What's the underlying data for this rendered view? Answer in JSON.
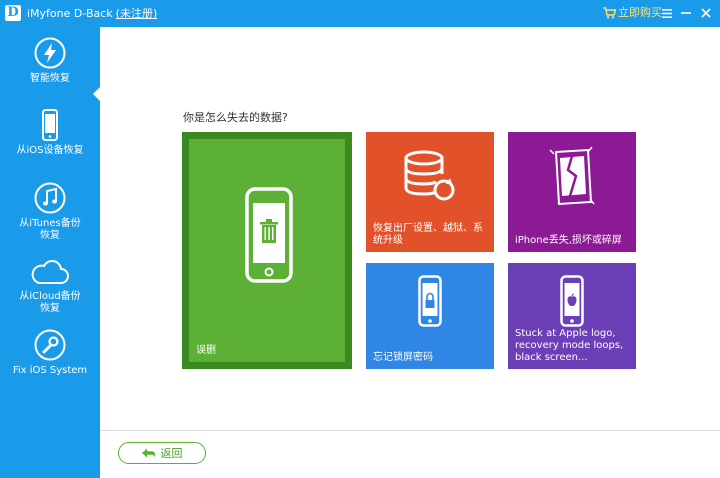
{
  "titlebar": {
    "logo_letter": "D",
    "app_name": "iMyfone D-Back",
    "registration": "(未注册)",
    "buy_label": "立即购买"
  },
  "sidebar": {
    "items": [
      {
        "label": "智能恢复",
        "icon": "lightning-icon"
      },
      {
        "label": "从iOS设备恢复",
        "icon": "iphone-icon"
      },
      {
        "label": "从iTunes备份\n恢复",
        "icon": "music-note-icon"
      },
      {
        "label": "从iCloud备份\n恢复",
        "icon": "cloud-icon"
      },
      {
        "label": "Fix iOS System",
        "icon": "wrench-icon"
      }
    ]
  },
  "main": {
    "question": "你是怎么失去的数据?",
    "tiles": [
      {
        "label": "误删",
        "icon": "phone-trash-icon",
        "color": "#5cb035"
      },
      {
        "label": "恢复出厂设置、越狱、系统升级",
        "icon": "database-restore-icon",
        "color": "#e2522a"
      },
      {
        "label": "iPhone丢失,损坏或碎屏",
        "icon": "broken-phone-icon",
        "color": "#8d1a95"
      },
      {
        "label": "忘记锁屏密码",
        "icon": "phone-lock-icon",
        "color": "#2f86e4"
      },
      {
        "label": "Stuck at Apple logo, recovery mode loops, black screen...",
        "icon": "phone-apple-icon",
        "color": "#6b3fb5"
      }
    ]
  },
  "footer": {
    "back_label": "返回"
  },
  "colors": {
    "brand": "#1a9bea",
    "accent_green": "#5cb035"
  }
}
